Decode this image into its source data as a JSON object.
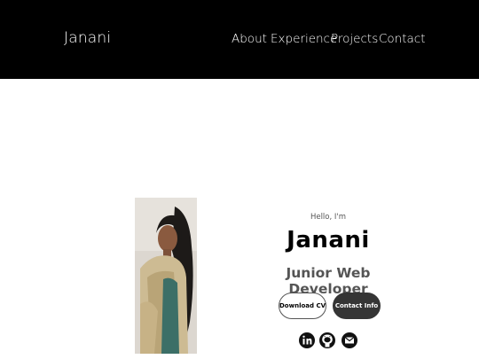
{
  "nav": {
    "logo": "Janani",
    "links": [
      "About",
      "Experience",
      "Projects",
      "Contact"
    ]
  },
  "hero": {
    "greeting": "Hello, I'm",
    "name": "Janani",
    "role": "Junior Web Developer",
    "buttons": {
      "download_cv": "Download CV",
      "contact_info": "Contact Info"
    },
    "socials": [
      "linkedin-icon",
      "github-icon",
      "email-icon"
    ]
  },
  "colors": {
    "navbar_bg": "#000000",
    "primary_button_bg": "#353535",
    "text_primary": "#000000",
    "text_secondary": "#555555"
  }
}
